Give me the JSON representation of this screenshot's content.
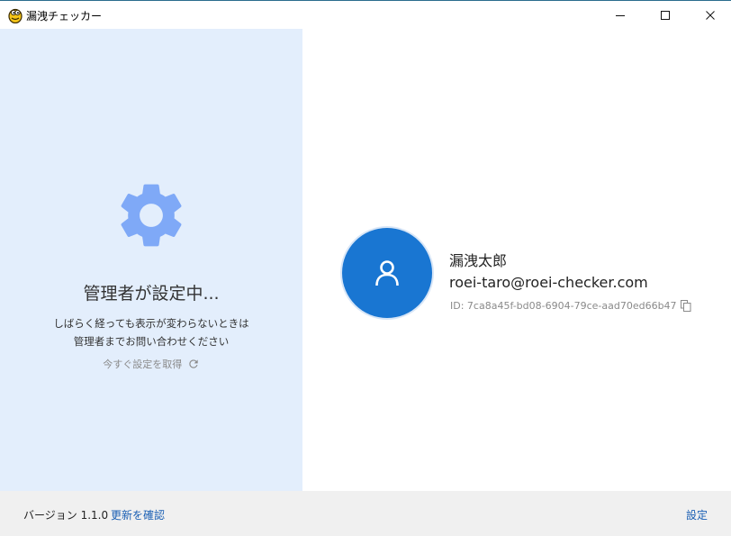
{
  "window": {
    "title": "漏洩チェッカー",
    "icon": "app-logo-icon",
    "controls": [
      "minimize-icon",
      "maximize-icon",
      "close-icon"
    ]
  },
  "left_panel": {
    "background": "#e3eefc",
    "icon": "gear-icon",
    "icon_color": "#7fa9f7",
    "title": "管理者が設定中...",
    "message_line1": "しばらく経っても表示が変わらないときは",
    "message_line2": "管理者までお問い合わせください",
    "fetch_link": "今すぐ設定を取得"
  },
  "user": {
    "avatar_icon": "person-icon",
    "avatar_color": "#1976d2",
    "name": "漏洩太郎",
    "email": "roei-taro@roei-checker.com",
    "id": "ID: 7ca8a45f-bd08-6904-79ce-aad70ed66b47"
  },
  "footer": {
    "version": "バージョン 1.1.0",
    "update_link": "更新を確認",
    "settings_link": "設定",
    "link_color": "#1a5fb4"
  }
}
